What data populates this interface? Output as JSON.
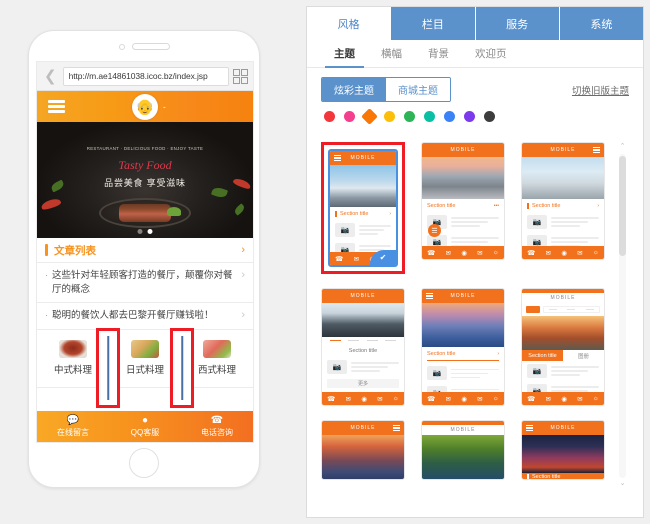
{
  "phone": {
    "browser": {
      "back_icon": "chevron-left",
      "url": "http://m.ae14861038.icoc.bz/index.jsp",
      "qr_icon": "qr-code-icon"
    },
    "site_header": {
      "menu_icon": "hamburger-icon",
      "logo_icon": "chef-logo",
      "title": "-"
    },
    "hero": {
      "arc_text": "RESTAURANT · DELICIOUS FOOD · ENJOY TASTE",
      "script_text": "Tasty Food",
      "subtitle": "品尝美食 享受滋味",
      "dots": [
        "",
        ""
      ],
      "active_dot_index": 1
    },
    "article_section": {
      "title": "文章列表",
      "arrow": "›",
      "rows": [
        {
          "bullet": "·",
          "text": "这些针对年轻顾客打造的餐厅，颠覆你对餐厅的概念",
          "arrow": "›"
        },
        {
          "bullet": "·",
          "text": "聪明的餐饮人都去巴黎开餐厅赚钱啦！",
          "arrow": "›"
        }
      ]
    },
    "categories": [
      {
        "label": "中式料理",
        "icon": "chinese-dish-icon"
      },
      {
        "label": "日式料理",
        "icon": "japanese-dish-icon"
      },
      {
        "label": "西式料理",
        "icon": "western-dish-icon"
      }
    ],
    "bottom_nav": [
      {
        "label": "在线留言",
        "icon": "message-icon"
      },
      {
        "label": "QQ客服",
        "icon": "qq-icon"
      },
      {
        "label": "电话咨询",
        "icon": "phone-icon"
      }
    ]
  },
  "admin": {
    "main_tabs": [
      {
        "label": "风格",
        "active": true
      },
      {
        "label": "栏目",
        "active": false
      },
      {
        "label": "服务",
        "active": false
      },
      {
        "label": "系统",
        "active": false
      }
    ],
    "sub_tabs": [
      {
        "label": "主题",
        "active": true
      },
      {
        "label": "横幅",
        "active": false
      },
      {
        "label": "背景",
        "active": false
      },
      {
        "label": "欢迎页",
        "active": false
      }
    ],
    "segmented": [
      {
        "label": "炫彩主题",
        "active": true
      },
      {
        "label": "商城主题",
        "active": false
      }
    ],
    "switch_old_link": "切换旧版主题",
    "colors": {
      "accent_blue": "#5b92cc",
      "accent_orange": "#f2711c",
      "annotation_red": "#ee1c25",
      "selected_blue": "#4a90e2"
    },
    "swatches": [
      {
        "hex": "#f2363c",
        "selected": false
      },
      {
        "hex": "#f33f8e",
        "selected": false
      },
      {
        "hex": "#f97706",
        "selected": true
      },
      {
        "hex": "#fbbf0b",
        "selected": false
      },
      {
        "hex": "#2eb457",
        "selected": false
      },
      {
        "hex": "#0bbfa4",
        "selected": false
      },
      {
        "hex": "#3b82f6",
        "selected": false
      },
      {
        "hex": "#7c3aed",
        "selected": false
      },
      {
        "hex": "#3d3d3d",
        "selected": false
      }
    ],
    "templates": [
      {
        "id": "tpl-1",
        "mobile_label": "MOBILE",
        "section_title": "Section title",
        "arrow": "›",
        "selected": true,
        "marked": true,
        "bottom_icons": [
          "phone-icon",
          "message-icon",
          "location-icon",
          "mail-icon"
        ],
        "check_icon": "check-icon"
      },
      {
        "id": "tpl-2",
        "mobile_label": "MOBILE",
        "section_title": "Section title",
        "arrow": "•••",
        "selected": false,
        "marked": false,
        "bottom_icons": [
          "phone-icon",
          "message-icon",
          "location-icon",
          "mail-icon",
          "bell-icon"
        ]
      },
      {
        "id": "tpl-3",
        "mobile_label": "MOBILE",
        "section_title": "Section title",
        "arrow": "›",
        "selected": false,
        "marked": false,
        "bottom_icons": [
          "phone-icon",
          "message-icon",
          "location-icon",
          "mail-icon",
          "bell-icon"
        ]
      },
      {
        "id": "tpl-4",
        "mobile_label": "MOBILE",
        "section_title": "Section title",
        "more_label": "更多",
        "selected": false,
        "marked": false,
        "bottom_icons": [
          "phone-icon",
          "message-icon",
          "location-icon",
          "mail-icon",
          "bell-icon"
        ]
      },
      {
        "id": "tpl-5",
        "mobile_label": "MOBILE",
        "section_title": "Section title",
        "arrow": "›",
        "selected": false,
        "marked": false,
        "bottom_icons": [
          "phone-icon",
          "message-icon",
          "location-icon",
          "mail-icon",
          "bell-icon"
        ]
      },
      {
        "id": "tpl-6",
        "mobile_label": "MOBILE",
        "section_title": "Section title",
        "tab_label": "图册",
        "selected": false,
        "marked": false,
        "bottom_icons": [
          "phone-icon",
          "message-icon",
          "location-icon",
          "mail-icon",
          "bell-icon"
        ]
      },
      {
        "id": "tpl-7",
        "mobile_label": "MOBILE",
        "section_title": "",
        "selected": false,
        "marked": false,
        "bottom_icons": []
      },
      {
        "id": "tpl-8",
        "mobile_label": "MOBILE",
        "section_title": "",
        "selected": false,
        "marked": false,
        "bottom_icons": []
      },
      {
        "id": "tpl-9",
        "mobile_label": "MOBILE",
        "section_title": "Section title",
        "selected": false,
        "marked": false,
        "bottom_icons": []
      }
    ],
    "scrollbar": {
      "up_arrow": "⌃",
      "down_arrow": "⌄"
    }
  }
}
